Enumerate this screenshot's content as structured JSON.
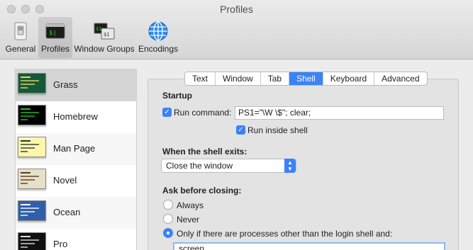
{
  "window": {
    "title": "Profiles"
  },
  "toolbar": {
    "items": [
      {
        "label": "General",
        "icon": "switch-icon"
      },
      {
        "label": "Profiles",
        "icon": "terminal-icon"
      },
      {
        "label": "Window Groups",
        "icon": "window-groups-icon"
      },
      {
        "label": "Encodings",
        "icon": "globe-icon"
      }
    ]
  },
  "profiles": [
    {
      "name": "Grass",
      "bg": "#14593a",
      "accent": "#f3d45e"
    },
    {
      "name": "Homebrew",
      "bg": "#000000",
      "accent": "#29c12a"
    },
    {
      "name": "Man Page",
      "bg": "#fdf7ac",
      "accent": "#333333"
    },
    {
      "name": "Novel",
      "bg": "#e7e0c8",
      "accent": "#5a3a20"
    },
    {
      "name": "Ocean",
      "bg": "#2f5fa8",
      "accent": "#ffffff"
    },
    {
      "name": "Pro",
      "bg": "#111111",
      "accent": "#dddddd"
    }
  ],
  "tabs": [
    "Text",
    "Window",
    "Tab",
    "Shell",
    "Keyboard",
    "Advanced"
  ],
  "active_tab": "Shell",
  "startup": {
    "heading": "Startup",
    "run_command_label": "Run command:",
    "run_command_value": "PS1=\"\\W \\$\"; clear;",
    "run_inside_shell_label": "Run inside shell"
  },
  "shell_exits": {
    "heading": "When the shell exits:",
    "selected": "Close the window"
  },
  "ask_closing": {
    "heading": "Ask before closing:",
    "options": [
      "Always",
      "Never",
      "Only if there are processes other than the login shell and:"
    ],
    "selected_index": 2,
    "process_list_first": "screen"
  },
  "colors": {
    "accent": "#3b82f7"
  }
}
